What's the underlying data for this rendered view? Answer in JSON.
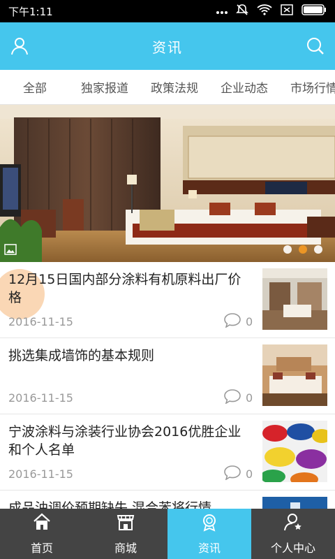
{
  "statusbar": {
    "time": "下午1:11",
    "icons": [
      "dots-icon",
      "mute-icon",
      "wifi-icon",
      "sim-icon",
      "battery-icon"
    ]
  },
  "header": {
    "title": "资讯",
    "left_icon": "user-icon",
    "right_icon": "search-icon"
  },
  "tabs": [
    "全部",
    "独家报道",
    "政策法规",
    "企业动态",
    "市场行情"
  ],
  "banner": {
    "dots": 3,
    "active_dot": 2
  },
  "news": [
    {
      "title": "12月15日国内部分涂料有机原料出厂价格",
      "date": "2016-11-15",
      "comments": "0"
    },
    {
      "title": "挑选集成墙饰的基本规则",
      "date": "2016-11-15",
      "comments": "0"
    },
    {
      "title": "宁波涂料与涂装行业协会2016优胜企业和个人名单",
      "date": "2016-11-15",
      "comments": "0"
    },
    {
      "title": "成品油调价预期缺失 混合苯将行情",
      "date": "",
      "comments": ""
    }
  ],
  "bottomnav": [
    {
      "label": "首页",
      "icon": "home-icon"
    },
    {
      "label": "商城",
      "icon": "shop-icon"
    },
    {
      "label": "资讯",
      "icon": "news-icon",
      "active": true
    },
    {
      "label": "个人中心",
      "icon": "profile-icon"
    }
  ],
  "colors": {
    "accent": "#45c6ed",
    "nav_bg": "#444444",
    "active_dot": "#f59a23"
  }
}
